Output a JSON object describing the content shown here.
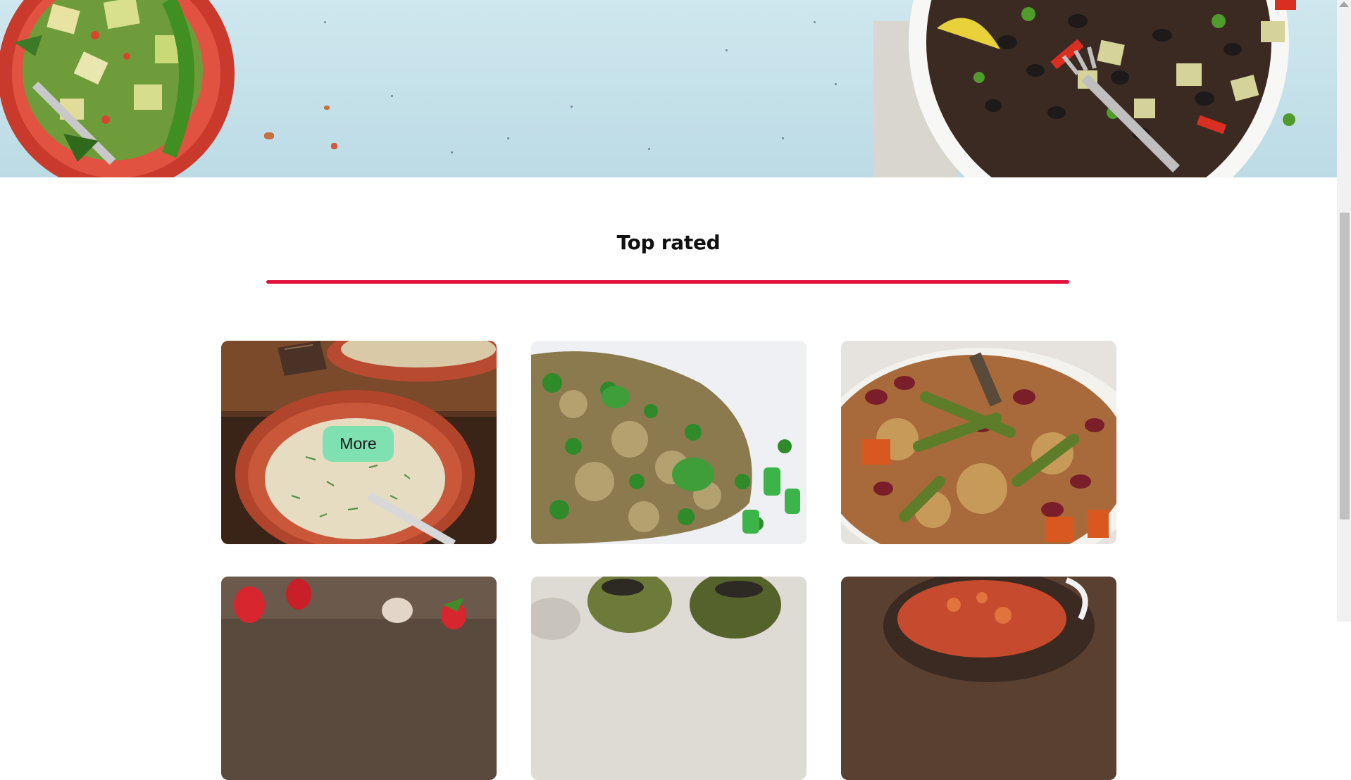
{
  "section": {
    "title": "Top rated"
  },
  "cards": [
    {
      "name": "soup",
      "button_label": "More"
    },
    {
      "name": "rice-peas"
    },
    {
      "name": "bean-rice"
    },
    {
      "name": "strawberry"
    },
    {
      "name": "grilled-veg"
    },
    {
      "name": "tomato-dish"
    }
  ],
  "colors": {
    "accent": "#e0103a",
    "button": "#7fe0b0",
    "hero_bg": "#c3e0e9"
  },
  "scrollbar": {
    "thumb_color": "#c1c1c1"
  }
}
